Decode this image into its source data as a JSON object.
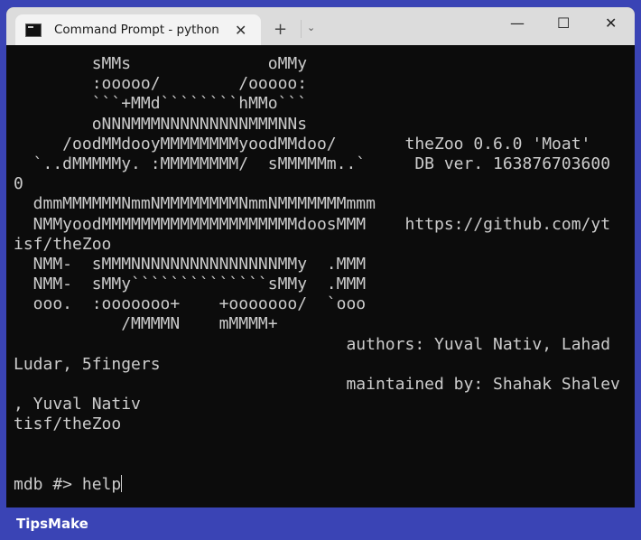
{
  "window": {
    "tab_title": "Command Prompt - python  t",
    "new_tab": "+",
    "dropdown": "⌄",
    "minimize": "—",
    "maximize": "☐",
    "close": "✕",
    "tab_close": "✕"
  },
  "terminal": {
    "lines": [
      "        sMMs              oMMy",
      "        :ooooo/        /ooooo:",
      "        ```+MMd````````hMMo```",
      "        oNNNMMMNNNNNNNNNMMMNNs",
      "     /oodMMdooyMMMMMMMMyoodMMdoo/       theZoo 0.6.0 'Moat'",
      "  `..dMMMMMy. :MMMMMMMM/  sMMMMMm..`     DB ver. 163876703600",
      "0",
      "  dmmMMMMMMNmmNMMMMMMMMNmmNMMMMMMMmmm",
      "  NMMyoodMMMMMMMMMMMMMMMMMMMMdoosMMM    https://github.com/yt",
      "isf/theZoo",
      "  NMM-  sMMMNNNNNNNNNNNNNNNMMy  .MMM",
      "  NMM-  sMMy``````````````sMMy  .MMM",
      "  ooo.  :ooooooo+    +ooooooo/  `ooo",
      "           /MMMMN    mMMMM+",
      "                                  authors: Yuval Nativ, Lahad",
      "Ludar, 5fingers",
      "                                  maintained by: Shahak Shalev",
      ", Yuval Nativ",
      "tisf/theZoo",
      "",
      ""
    ],
    "prompt": "mdb #> help"
  },
  "footer": {
    "brand": "TipsMake"
  }
}
